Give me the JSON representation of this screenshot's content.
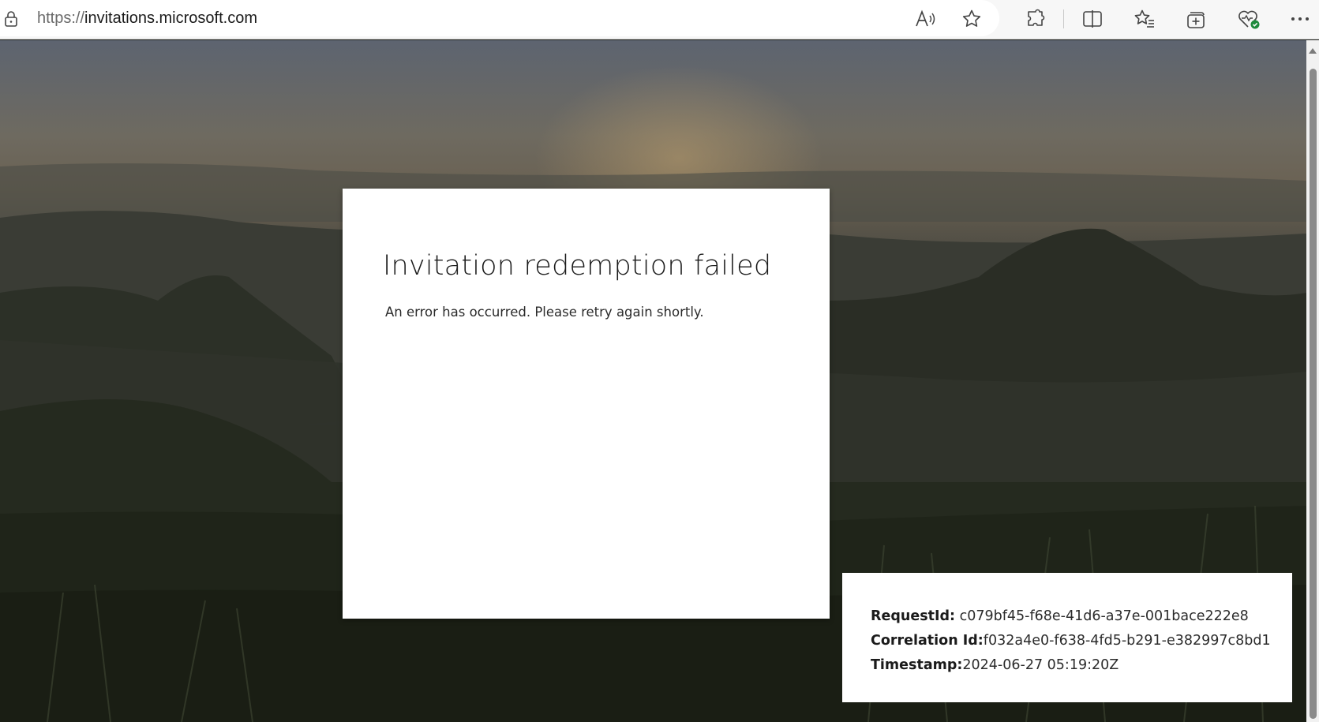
{
  "browser": {
    "url_protocol": "https://",
    "url_host": "invitations.microsoft.com",
    "toolbar_icons": [
      "read-aloud-icon",
      "favorite-star-icon",
      "extensions-icon",
      "split-screen-icon",
      "favorites-icon",
      "collections-icon",
      "browser-essentials-icon",
      "more-options-icon"
    ]
  },
  "error_card": {
    "title": "Invitation redemption failed",
    "message": "An error has occurred. Please retry again shortly."
  },
  "debug_info": {
    "request_label": "RequestId:",
    "request_value": " c079bf45-f68e-41d6-a37e-001bace222e8",
    "correlation_label": "Correlation Id:",
    "correlation_value": "f032a4e0-f638-4fd5-b291-e382997c8bd1",
    "timestamp_label": "Timestamp:",
    "timestamp_value": "2024-06-27 05:19:20Z"
  },
  "colors": {
    "card_bg": "#ffffff",
    "text_dark": "#1b1b1b",
    "toolbar_bg": "#f7f7f7",
    "health_badge": "#1e8a3c"
  }
}
